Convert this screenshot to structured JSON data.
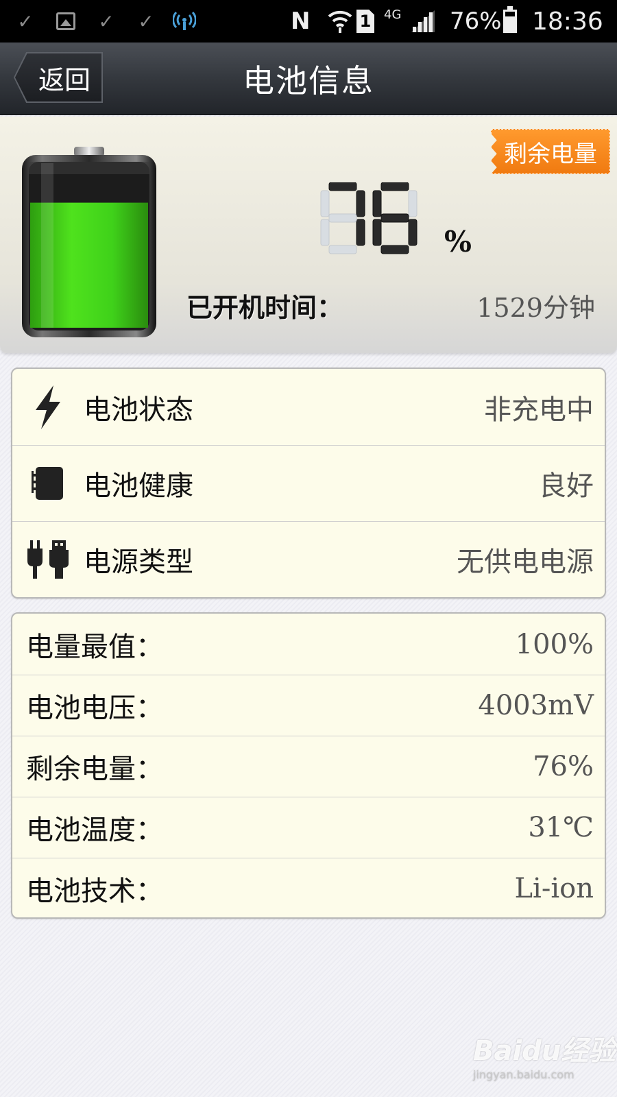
{
  "status_bar": {
    "network_label": "4G",
    "sim_label": "1",
    "carrier_icon": "N",
    "battery_percent": "76%",
    "battery_level": 0.76,
    "time": "18:36",
    "icons": [
      "check-icon",
      "image-icon",
      "check-icon",
      "check-icon",
      "broadcast-icon",
      "nfc-icon",
      "wifi-icon",
      "sim-icon",
      "signal-icon",
      "battery-icon"
    ]
  },
  "header": {
    "back_label": "返回",
    "title": "电池信息"
  },
  "summary": {
    "remaining_tag": "剩余电量",
    "level_display": "76",
    "level_value": 76,
    "percent_sign": "%",
    "battery_fill_level": 0.76,
    "uptime_label": "已开机时间：",
    "uptime_value": "1529分钟"
  },
  "status_rows": [
    {
      "icon": "lightning-icon",
      "label": "电池状态",
      "value": "非充电中"
    },
    {
      "icon": "battery-chip-icon",
      "label": "电池健康",
      "value": "良好"
    },
    {
      "icon": "power-plug-icon",
      "label": "电源类型",
      "value": "无供电电源"
    }
  ],
  "detail_rows": [
    {
      "label": "电量最值：",
      "value": "100%"
    },
    {
      "label": "电池电压：",
      "value": "4003mV"
    },
    {
      "label": "剩余电量：",
      "value": "76%"
    },
    {
      "label": "电池温度：",
      "value": "31℃"
    },
    {
      "label": "电池技术：",
      "value": "Li-ion"
    }
  ],
  "watermark": {
    "main": "Baidu经验",
    "sub": "jingyan.baidu.com"
  },
  "colors": {
    "title_bar": "#34383e",
    "battery_green": "#3fd11a",
    "remaining_tag": "#f5841f",
    "card_bg": "#fdfcea"
  }
}
